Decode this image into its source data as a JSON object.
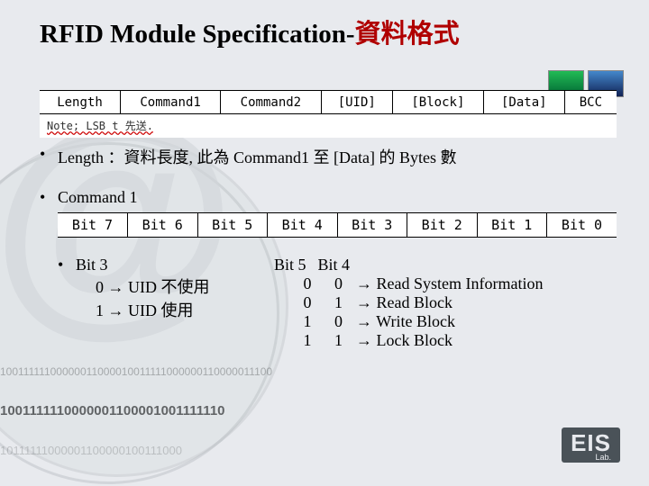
{
  "title": {
    "black": "RFID Module Specification-",
    "red": "資料格式"
  },
  "packet_fields": [
    "Length",
    "Command1",
    "Command2",
    "[UID]",
    "[Block]",
    "[Data]",
    "BCC"
  ],
  "note": "Note; LSB t 先送.",
  "bullets": {
    "length": "Length ：資料長度, 此為 Command1 至 [Data] 的 Bytes 數",
    "command1": "Command 1"
  },
  "bits_header": [
    "Bit 7",
    "Bit 6",
    "Bit 5",
    "Bit 4",
    "Bit 3",
    "Bit 2",
    "Bit 1",
    "Bit 0"
  ],
  "bit3": {
    "title": "Bit 3",
    "lines": [
      {
        "v": "0",
        "arrow": "→",
        "text": "UID 不使用"
      },
      {
        "v": "1",
        "arrow": "→",
        "text": "UID 使用"
      }
    ]
  },
  "bit54": {
    "h5": "Bit 5",
    "h4": "Bit 4",
    "rows": [
      {
        "b5": "0",
        "b4": "0",
        "arrow": "→",
        "text": "Read System Information"
      },
      {
        "b5": "0",
        "b4": "1",
        "arrow": "→",
        "text": "Read Block"
      },
      {
        "b5": "1",
        "b4": "0",
        "arrow": "→",
        "text": "Write Block"
      },
      {
        "b5": "1",
        "b4": "1",
        "arrow": "→",
        "text": "Lock Block"
      }
    ]
  },
  "logo": {
    "big": "EIS",
    "small": "Lab."
  },
  "bg": {
    "b1": "10011111100000011000010011111000000110000011100",
    "b2": "1001111110000001100001001111110",
    "b3": "10111111000001100000100111000"
  }
}
